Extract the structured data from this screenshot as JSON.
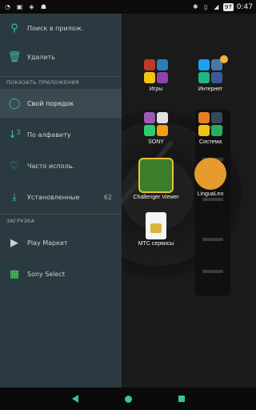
{
  "statusbar": {
    "left_icons": [
      "wifi-icon",
      "image-icon",
      "screenshot-icon",
      "android-icon"
    ],
    "right_icons": [
      "bluetooth-icon",
      "vibrate-icon",
      "signal-icon"
    ],
    "battery": "97",
    "time": "0:47"
  },
  "drawer": {
    "search": {
      "label": "Поиск в прилож."
    },
    "delete": {
      "label": "Удалить"
    },
    "section_show": "ПОКАЗАТЬ ПРИЛОЖЕНИЯ",
    "sort_own": {
      "label": "Свой порядок"
    },
    "sort_alpha": {
      "label": "По алфавиту"
    },
    "sort_frequent": {
      "label": "Часто исполь."
    },
    "installed": {
      "label": "Установленные",
      "count": "62"
    },
    "section_download": "ЗАГРУЗКА",
    "play": {
      "label": "Play Маркет"
    },
    "sony_select": {
      "label": "Sony Select"
    }
  },
  "home": {
    "apps": [
      {
        "label": "Игры"
      },
      {
        "label": "Интернет"
      },
      {
        "label": "SONY"
      },
      {
        "label": "Система"
      },
      {
        "label": "Challenger Viewer"
      },
      {
        "label": "LinguaLeo"
      },
      {
        "label": "МТС сервисы"
      }
    ]
  },
  "colors": {
    "accent": "#3cc1a4",
    "drawer_bg": "#2b3a40",
    "selected_bg": "#3a4a50"
  }
}
